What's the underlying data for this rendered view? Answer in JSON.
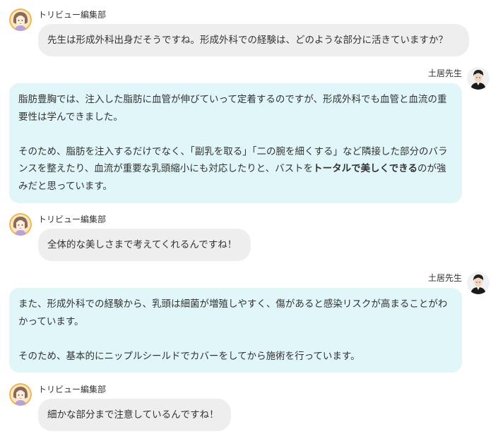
{
  "conversation": [
    {
      "speaker": "トリビュー編集部",
      "side": "left",
      "avatar_icon": "woman-avatar-icon",
      "paragraphs": [
        [
          {
            "text": "先生は形成外科出身だそうですね。形成外科での経験は、どのような部分に活きていますか？",
            "bold": false
          }
        ]
      ]
    },
    {
      "speaker": "土居先生",
      "side": "right",
      "avatar_icon": "doctor-avatar-icon",
      "paragraphs": [
        [
          {
            "text": "脂肪豊胸では、注入した脂肪に血管が伸びていって定着するのですが、形成外科でも血管と血流の重要性は学んできました。",
            "bold": false
          }
        ],
        [
          {
            "text": "そのため、脂肪を注入するだけでなく、「副乳を取る」「二の腕を細くする」など隣接した部分のバランスを整えたり、血流が重要な乳頭縮小にも対応したりと、バストを",
            "bold": false
          },
          {
            "text": "トータルで美しくできる",
            "bold": true
          },
          {
            "text": "のが強みだと思っています。",
            "bold": false
          }
        ]
      ]
    },
    {
      "speaker": "トリビュー編集部",
      "side": "left",
      "avatar_icon": "woman-avatar-icon",
      "paragraphs": [
        [
          {
            "text": "全体的な美しさまで考えてくれるんですね！",
            "bold": false
          }
        ]
      ]
    },
    {
      "speaker": "土居先生",
      "side": "right",
      "avatar_icon": "doctor-avatar-icon",
      "paragraphs": [
        [
          {
            "text": "また、形成外科での経験から、乳頭は細菌が増殖しやすく、傷があると感染リスクが高まることがわかっています。",
            "bold": false
          }
        ],
        [
          {
            "text": "そのため、基本的にニップルシールドでカバーをしてから施術を行っています。",
            "bold": false
          }
        ]
      ]
    },
    {
      "speaker": "トリビュー編集部",
      "side": "left",
      "avatar_icon": "woman-avatar-icon",
      "paragraphs": [
        [
          {
            "text": "細かな部分まで注意しているんですね！",
            "bold": false
          }
        ]
      ]
    }
  ],
  "colors": {
    "editor_bubble": "#eeeeee",
    "doctor_bubble": "#e0f6f8",
    "text": "#333333"
  }
}
